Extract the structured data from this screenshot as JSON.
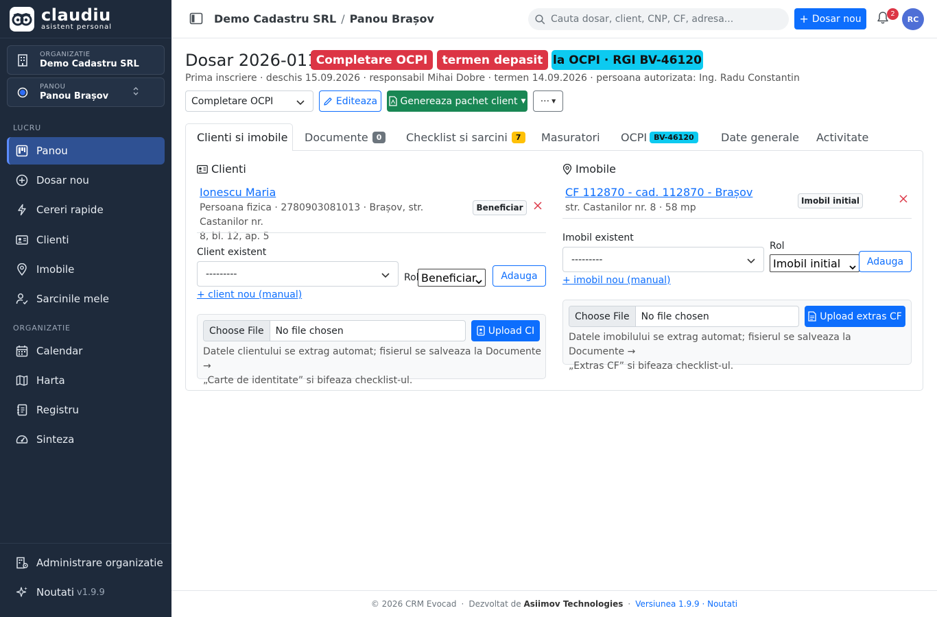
{
  "brand": {
    "name": "claudiu",
    "tagline": "asistent personal"
  },
  "org_switcher": {
    "label": "ORGANIZATIE",
    "value": "Demo Cadastru SRL"
  },
  "panel_switcher": {
    "label": "PANOU",
    "value": "Panou Brașov"
  },
  "sidebar": {
    "section_work": "LUCRU",
    "section_org": "ORGANIZATIE",
    "items": [
      {
        "label": "Panou",
        "icon": "kanban-icon"
      },
      {
        "label": "Dosar nou",
        "icon": "plus-circle-icon"
      },
      {
        "label": "Cereri rapide",
        "icon": "lightning-icon"
      },
      {
        "label": "Clienti",
        "icon": "person-vcard-icon"
      },
      {
        "label": "Imobile",
        "icon": "geo-pin-icon"
      },
      {
        "label": "Sarcinile mele",
        "icon": "person-check-icon"
      },
      {
        "label": "Calendar",
        "icon": "calendar-icon"
      },
      {
        "label": "Harta",
        "icon": "map-icon"
      },
      {
        "label": "Registru",
        "icon": "journal-icon"
      },
      {
        "label": "Sinteza",
        "icon": "speedometer-icon"
      }
    ],
    "admin": "Administrare organizatie",
    "news": "Noutati",
    "version": "v1.9.9"
  },
  "topbar": {
    "crumb_org": "Demo Cadastru SRL",
    "crumb_sep": "/",
    "crumb_panel": "Panou Brașov",
    "search_placeholder": "Cauta dosar, client, CNP, CF, adresa...",
    "new_button": "Dosar nou",
    "notifications": "2",
    "avatar": "RC"
  },
  "dosar": {
    "title": "Dosar 2026-011",
    "badges": [
      "Completare OCPI",
      "termen depasit",
      "la OCPI · RGI BV-46120"
    ],
    "meta": "Prima inscriere · deschis 15.09.2026 · responsabil Mihai Dobre · termen 14.09.2026 · persoana autorizata: Ing. Radu Constantin",
    "status_select": "Completare OCPI",
    "edit_button": "Editeaza",
    "generate_button": "Genereaza pachet client",
    "more_button": "···"
  },
  "tabs": [
    {
      "label": "Clienti si imobile"
    },
    {
      "label": "Documente",
      "count": "0"
    },
    {
      "label": "Checklist si sarcini",
      "count": "7"
    },
    {
      "label": "Masuratori"
    },
    {
      "label": "OCPI",
      "count": "BV-46120"
    },
    {
      "label": "Date generale"
    },
    {
      "label": "Activitate"
    }
  ],
  "clients": {
    "heading": "Clienti",
    "entry": {
      "name": "Ionescu Maria",
      "details_line1": "Persoana fizica · 2780903081013 · Brașov, str. Castanilor nr.",
      "details_line2": "8, bl. 12, ap. 5",
      "role": "Beneficiar"
    },
    "existing_label": "Client existent",
    "existing_value": "---------",
    "role_label": "Rol",
    "role_value": "Beneficiar",
    "add_button": "Adauga",
    "new_link": "+ client nou (manual)",
    "file_button": "Choose File",
    "file_status": "No file chosen",
    "upload_button": "Upload CI",
    "help_line1": "Datele clientului se extrag automat; fisierul se salveaza la Documente →",
    "help_line2": "„Carte de identitate” si bifeaza checklist-ul."
  },
  "properties": {
    "heading": "Imobile",
    "entry": {
      "title": "CF 112870 - cad. 112870 - Brașov",
      "details": "str. Castanilor nr. 8 · 58 mp",
      "role": "Imobil initial"
    },
    "existing_label": "Imobil existent",
    "existing_value": "---------",
    "role_label": "Rol",
    "role_value": "Imobil initial",
    "add_button": "Adauga",
    "new_link": "+ imobil nou (manual)",
    "file_button": "Choose File",
    "file_status": "No file chosen",
    "upload_button": "Upload extras CF",
    "help_line1": "Datele imobilului se extrag automat; fisierul se salveaza la Documente →",
    "help_line2": "„Extras CF” si bifeaza checklist-ul."
  },
  "footer": {
    "copyright": "© 2026 CRM Evocad",
    "dev_prefix": "Dezvoltat de",
    "dev_name": "Asiimov Technologies",
    "version_link": "Versiunea 1.9.9 · Noutati"
  },
  "colors": {
    "sidebar_bg": "#1e2a3b",
    "primary": "#0d6efd",
    "danger": "#dc3545",
    "info": "#0dcaf0",
    "success": "#198754",
    "warning": "#ffc107"
  }
}
